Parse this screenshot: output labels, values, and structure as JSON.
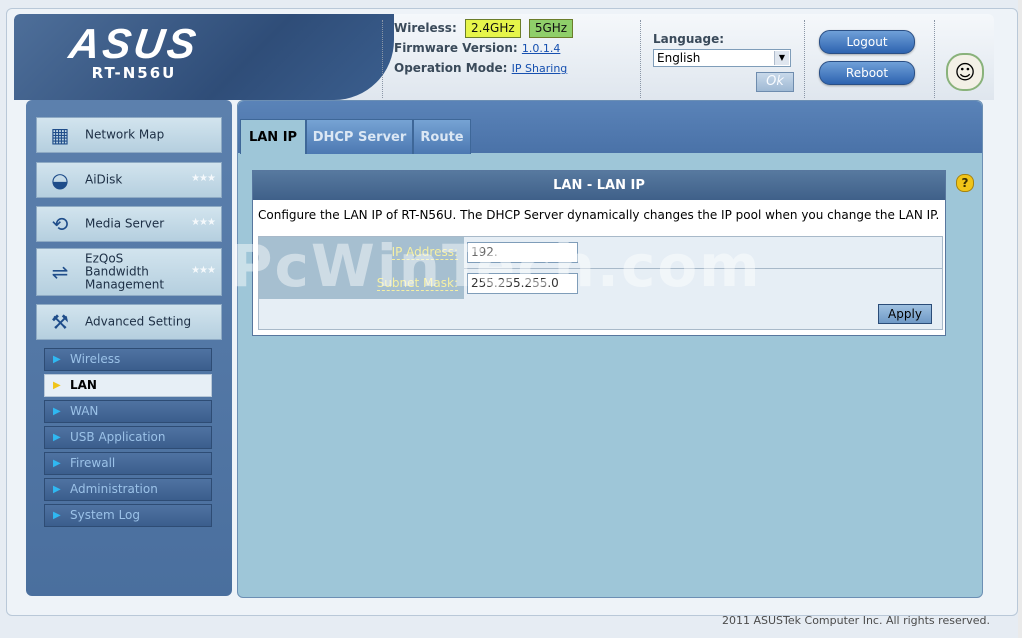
{
  "header": {
    "brand": "ASUS",
    "model": "RT-N56U",
    "wireless_label": "Wireless:",
    "band_24": "2.4GHz",
    "band_5": "5GHz",
    "firmware_label": "Firmware Version:",
    "firmware_value": "1.0.1.4",
    "opmode_label": "Operation Mode:",
    "opmode_value": "IP Sharing",
    "language_label": "Language:",
    "language_selected": "English",
    "ok_label": "Ok",
    "logout_label": "Logout",
    "reboot_label": "Reboot"
  },
  "sidebar": {
    "items": [
      {
        "label": "Network Map",
        "icon": "network-map-icon"
      },
      {
        "label": "AiDisk",
        "icon": "aidisk-icon",
        "stars": "★★★"
      },
      {
        "label": "Media Server",
        "icon": "media-server-icon",
        "stars": "★★★"
      },
      {
        "label": "EzQoS Bandwidth Management",
        "line1": "EzQoS",
        "line2": "Bandwidth",
        "line3": "Management",
        "icon": "ezqos-icon",
        "stars": "★★★"
      },
      {
        "label": "Advanced Setting",
        "icon": "advanced-setting-icon"
      }
    ],
    "subitems": [
      {
        "label": "Wireless"
      },
      {
        "label": "LAN",
        "active": true
      },
      {
        "label": "WAN"
      },
      {
        "label": "USB Application"
      },
      {
        "label": "Firewall"
      },
      {
        "label": "Administration"
      },
      {
        "label": "System Log"
      }
    ]
  },
  "main": {
    "tabs": [
      {
        "label": "LAN IP",
        "active": true
      },
      {
        "label": "DHCP Server"
      },
      {
        "label": "Route"
      }
    ],
    "panel_title": "LAN - LAN IP",
    "description": "Configure the LAN IP of RT-N56U. The DHCP Server dynamically changes the IP pool when you change the LAN IP.",
    "ip_label": "IP Address:",
    "ip_value": "192.",
    "mask_label": "Subnet Mask:",
    "mask_value": "255.255.255.0",
    "apply_label": "Apply"
  },
  "watermark": "PcWinTech.com",
  "footer": "2011 ASUSTek Computer Inc. All rights reserved.",
  "colors": {
    "band_24": "#e6f54a",
    "band_5": "#8fcf6a",
    "sidebar": "#4a6f9e",
    "panel_title": "#4a6c94",
    "help": "#f0c419"
  }
}
